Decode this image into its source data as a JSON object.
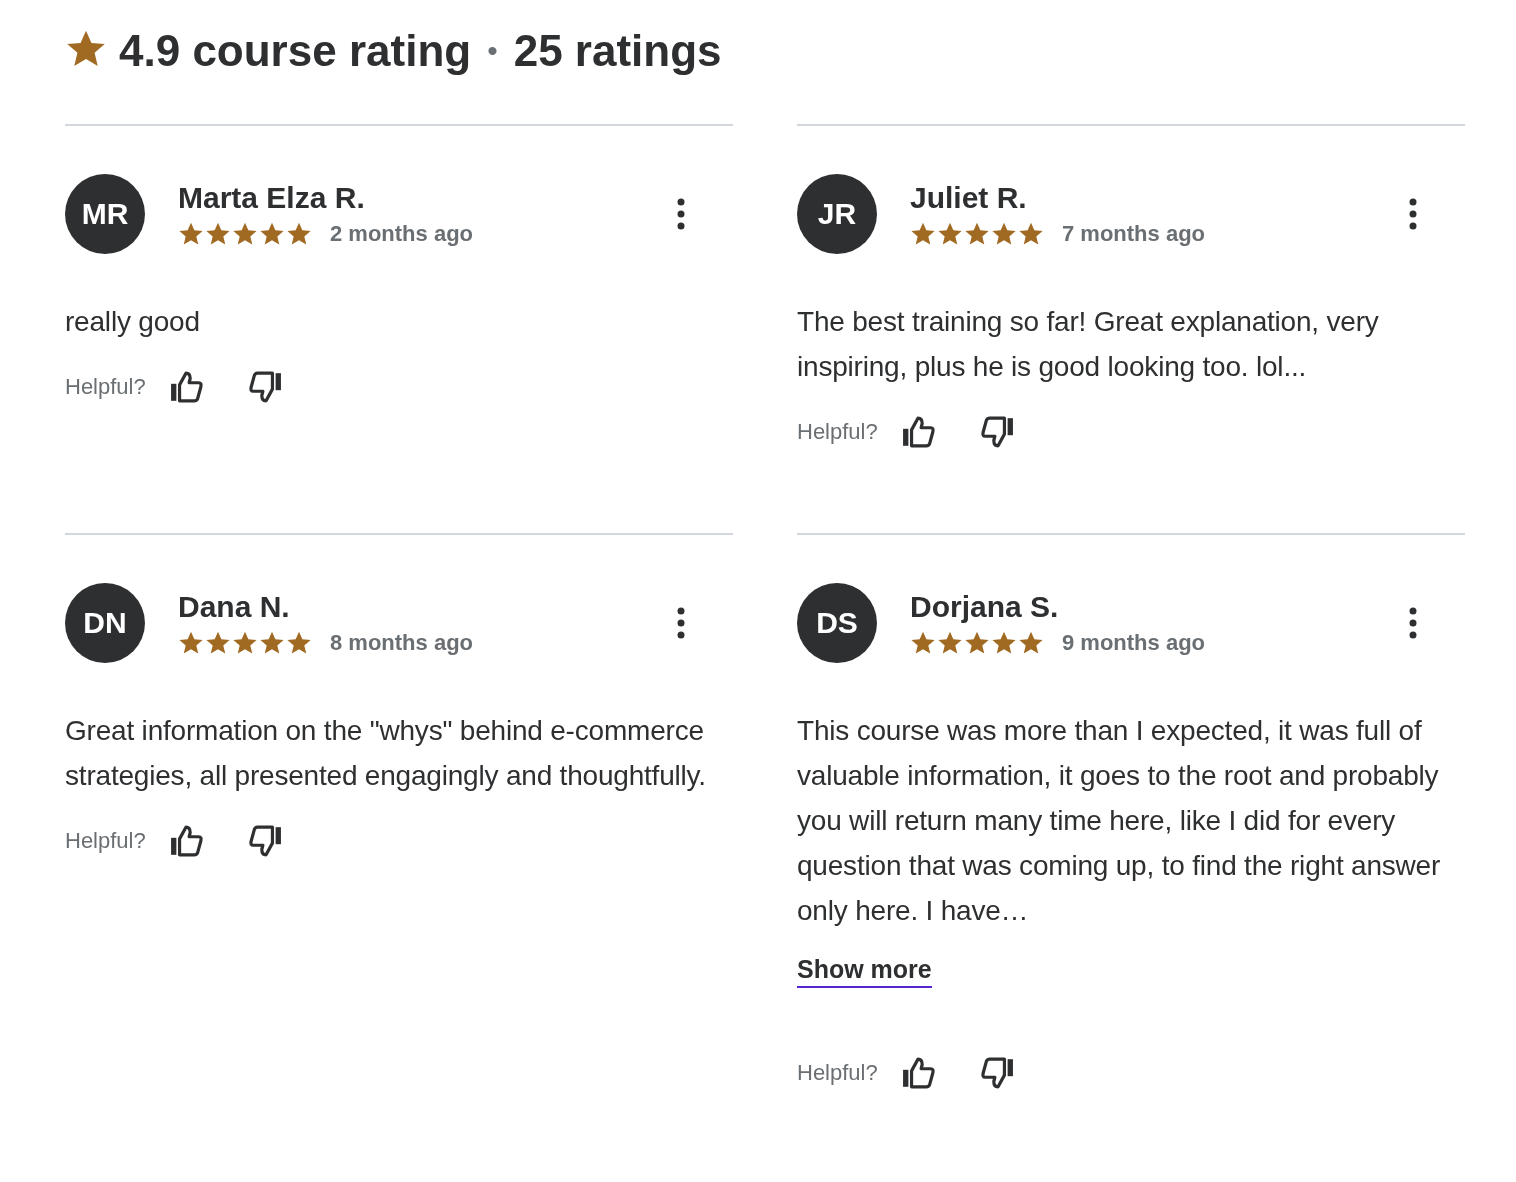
{
  "header": {
    "rating": "4.9 course rating",
    "separator": "•",
    "count": "25 ratings"
  },
  "reviews": [
    {
      "initials": "MR",
      "name": "Marta Elza R.",
      "stars": 5,
      "time": "2 months ago",
      "text": "really good",
      "helpful_label": "Helpful?"
    },
    {
      "initials": "JR",
      "name": "Juliet R.",
      "stars": 5,
      "time": "7 months ago",
      "text": "The best training so far! Great explanation, very inspiring, plus he is good looking too. lol...",
      "helpful_label": "Helpful?"
    },
    {
      "initials": "DN",
      "name": "Dana N.",
      "stars": 5,
      "time": "8 months ago",
      "text": "Great information on the \"whys\" behind e-commerce strategies, all presented engagingly and thoughtfully.",
      "helpful_label": "Helpful?"
    },
    {
      "initials": "DS",
      "name": "Dorjana S.",
      "stars": 5,
      "time": "9 months ago",
      "text": "This course was more than I expected, it was full of valuable information, it goes to the root and probably you will return many time here, like I did for every question that was coming up, to find the right answer only here. I have…",
      "show_more": "Show more",
      "helpful_label": "Helpful?"
    }
  ]
}
